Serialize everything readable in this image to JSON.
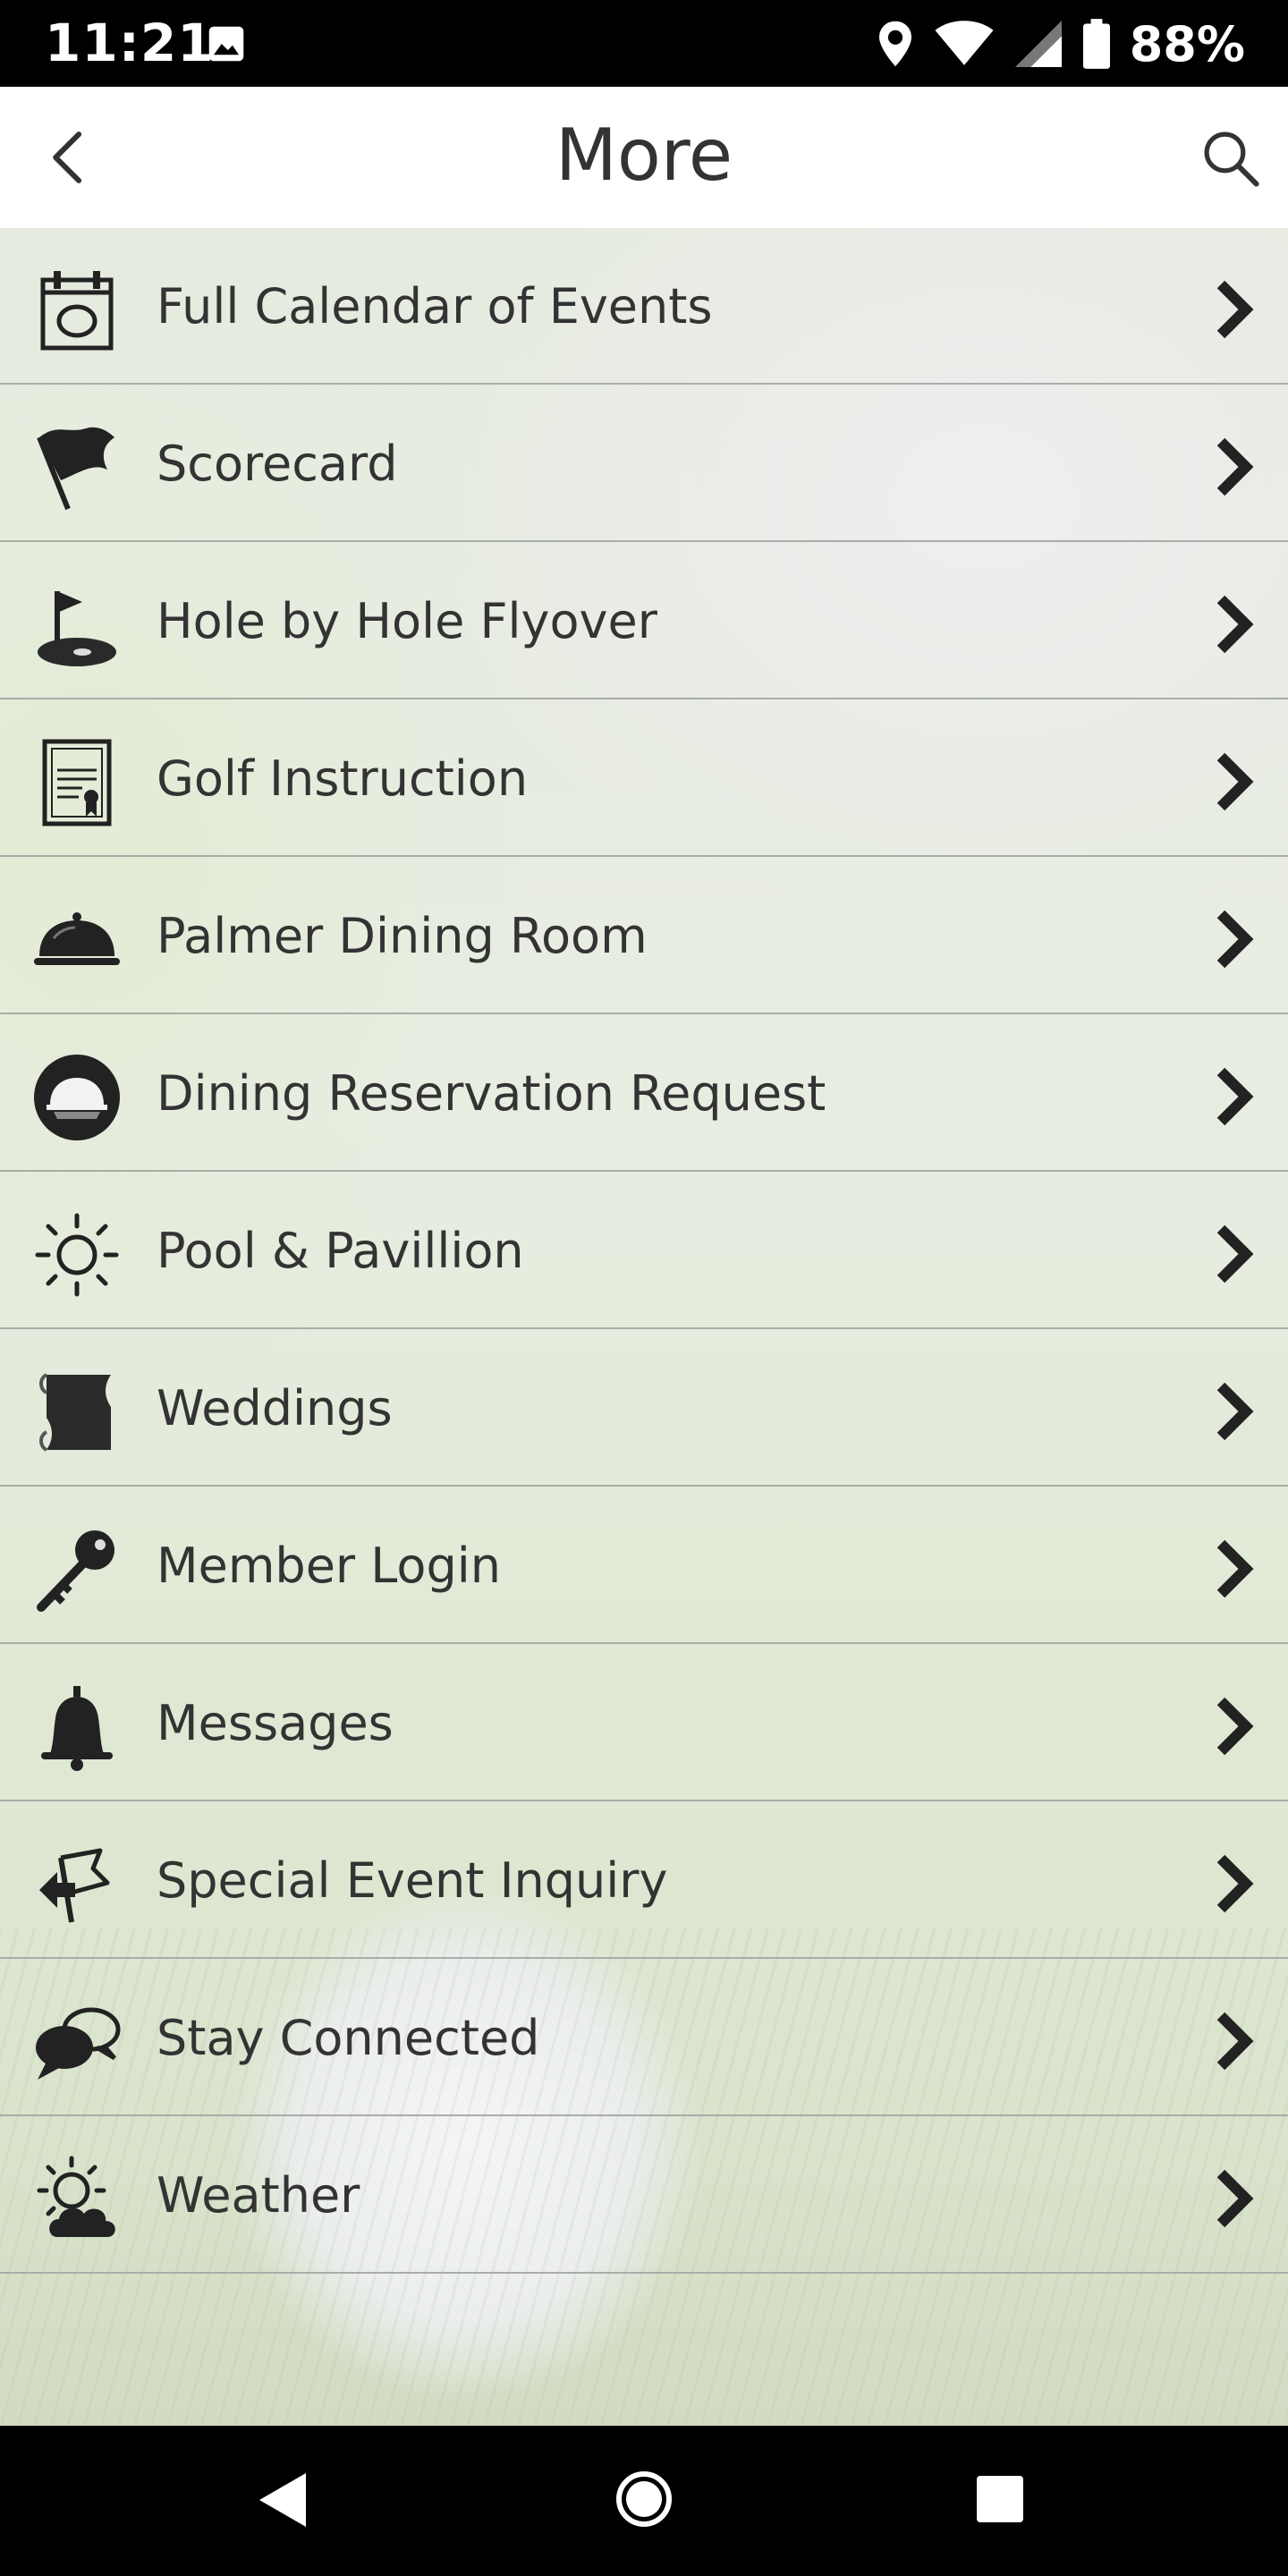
{
  "status_bar": {
    "time": "11:21",
    "battery": "88%",
    "icons": [
      "image-icon",
      "location-icon",
      "wifi-icon",
      "signal-icon",
      "battery-icon"
    ]
  },
  "app_bar": {
    "title": "More",
    "back_icon": "chevron-left-icon",
    "search_icon": "search-icon"
  },
  "menu": {
    "items": [
      {
        "label": "Full Calendar of Events",
        "icon": "calendar-icon"
      },
      {
        "label": "Scorecard",
        "icon": "flag-icon"
      },
      {
        "label": "Hole by Hole Flyover",
        "icon": "golf-hole-icon"
      },
      {
        "label": "Golf Instruction",
        "icon": "license-icon"
      },
      {
        "label": "Palmer Dining Room",
        "icon": "dining-cloche-icon"
      },
      {
        "label": "Dining Reservation Request",
        "icon": "dining-reservation-icon"
      },
      {
        "label": "Pool & Pavillion",
        "icon": "sun-icon"
      },
      {
        "label": "Weddings",
        "icon": "scroll-icon"
      },
      {
        "label": "Member Login",
        "icon": "key-icon"
      },
      {
        "label": "Messages",
        "icon": "bell-icon"
      },
      {
        "label": "Special Event Inquiry",
        "icon": "event-flag-icon"
      },
      {
        "label": "Stay Connected",
        "icon": "chat-bubbles-icon"
      },
      {
        "label": "Weather",
        "icon": "weather-icon"
      }
    ],
    "chevron_icon": "chevron-right-icon"
  },
  "nav_bar": {
    "back": "back-triangle-icon",
    "home": "home-circle-icon",
    "recents": "recents-square-icon"
  },
  "colors": {
    "row_divider": "#a9aca8",
    "text": "#333333",
    "status_bg": "#000000"
  }
}
